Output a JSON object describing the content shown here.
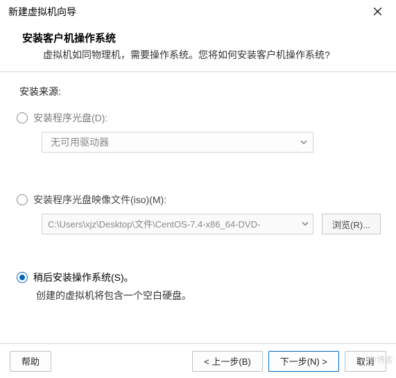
{
  "window": {
    "title": "新建虚拟机向导"
  },
  "header": {
    "title": "安装客户机操作系统",
    "subtitle": "虚拟机如同物理机，需要操作系统。您将如何安装客户机操作系统?"
  },
  "source": {
    "label": "安装来源:",
    "option_disc": {
      "label": "安装程序光盘(D):",
      "dropdown_text": "无可用驱动器"
    },
    "option_iso": {
      "label": "安装程序光盘映像文件(iso)(M):",
      "path": "C:\\Users\\xjz\\Desktop\\文件\\CentOS-7.4-x86_64-DVD-",
      "browse": "浏览(R)..."
    },
    "option_later": {
      "label": "稍后安装操作系统(S)。",
      "desc": "创建的虚拟机将包含一个空白硬盘。"
    }
  },
  "footer": {
    "help": "帮助",
    "back": "< 上一步(B)",
    "next": "下一步(N) >",
    "cancel": "取消"
  },
  "watermark": "TO博客"
}
